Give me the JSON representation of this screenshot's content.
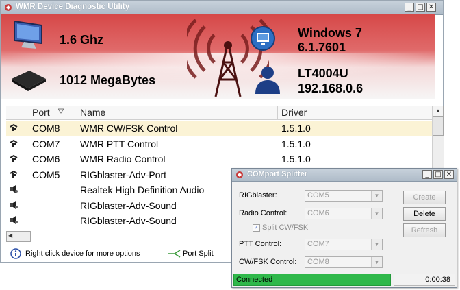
{
  "main_window": {
    "title": "WMR Device Diagnostic Utility",
    "controls": {
      "minimize": "_",
      "maximize": "□",
      "close": "✕"
    },
    "banner": {
      "cpu_speed": "1.6 Ghz",
      "memory": "1012 MegaBytes",
      "os_name": "Windows 7",
      "os_version": "6.1.7601",
      "computer_name": "LT4004U",
      "ip_address": "192.168.0.6"
    },
    "table": {
      "columns": [
        "Port",
        "Name",
        "Driver"
      ],
      "rows": [
        {
          "port": "COM8",
          "name": "WMR CW/FSK Control",
          "driver": "1.5.1.0",
          "icon": "serial-port-icon",
          "selected": true
        },
        {
          "port": "COM7",
          "name": "WMR PTT Control",
          "driver": "1.5.1.0",
          "icon": "serial-port-icon",
          "selected": false
        },
        {
          "port": "COM6",
          "name": "WMR Radio Control",
          "driver": "1.5.1.0",
          "icon": "serial-port-icon",
          "selected": false
        },
        {
          "port": "COM5",
          "name": "RIGblaster-Adv-Port",
          "driver": "",
          "icon": "serial-port-icon",
          "selected": false
        },
        {
          "port": "",
          "name": "Realtek High Definition Audio",
          "driver": "",
          "icon": "speaker-icon",
          "selected": false
        },
        {
          "port": "",
          "name": "RIGblaster-Adv-Sound",
          "driver": "",
          "icon": "speaker-icon",
          "selected": false
        },
        {
          "port": "",
          "name": "RIGblaster-Adv-Sound",
          "driver": "",
          "icon": "speaker-icon",
          "selected": false
        }
      ]
    },
    "status": {
      "hint": "Right click device for more options",
      "port_split": "Port Split"
    }
  },
  "dialog": {
    "title": "COMport Splitter",
    "fields": {
      "rigblaster_label": "RIGblaster:",
      "rigblaster_value": "COM5",
      "radio_label": "Radio Control:",
      "radio_value": "COM6",
      "split_label": "Split CW/FSK",
      "ptt_label": "PTT Control:",
      "ptt_value": "COM7",
      "cwfsk_label": "CW/FSK Control:",
      "cwfsk_value": "COM8"
    },
    "buttons": {
      "create": "Create",
      "delete": "Delete",
      "refresh": "Refresh"
    },
    "status": {
      "text": "Connected",
      "timer": "0:00:38"
    }
  },
  "colors": {
    "banner_red": "#d64848",
    "selected_row": "#fbf3d5",
    "connected_green": "#2fb84a"
  }
}
